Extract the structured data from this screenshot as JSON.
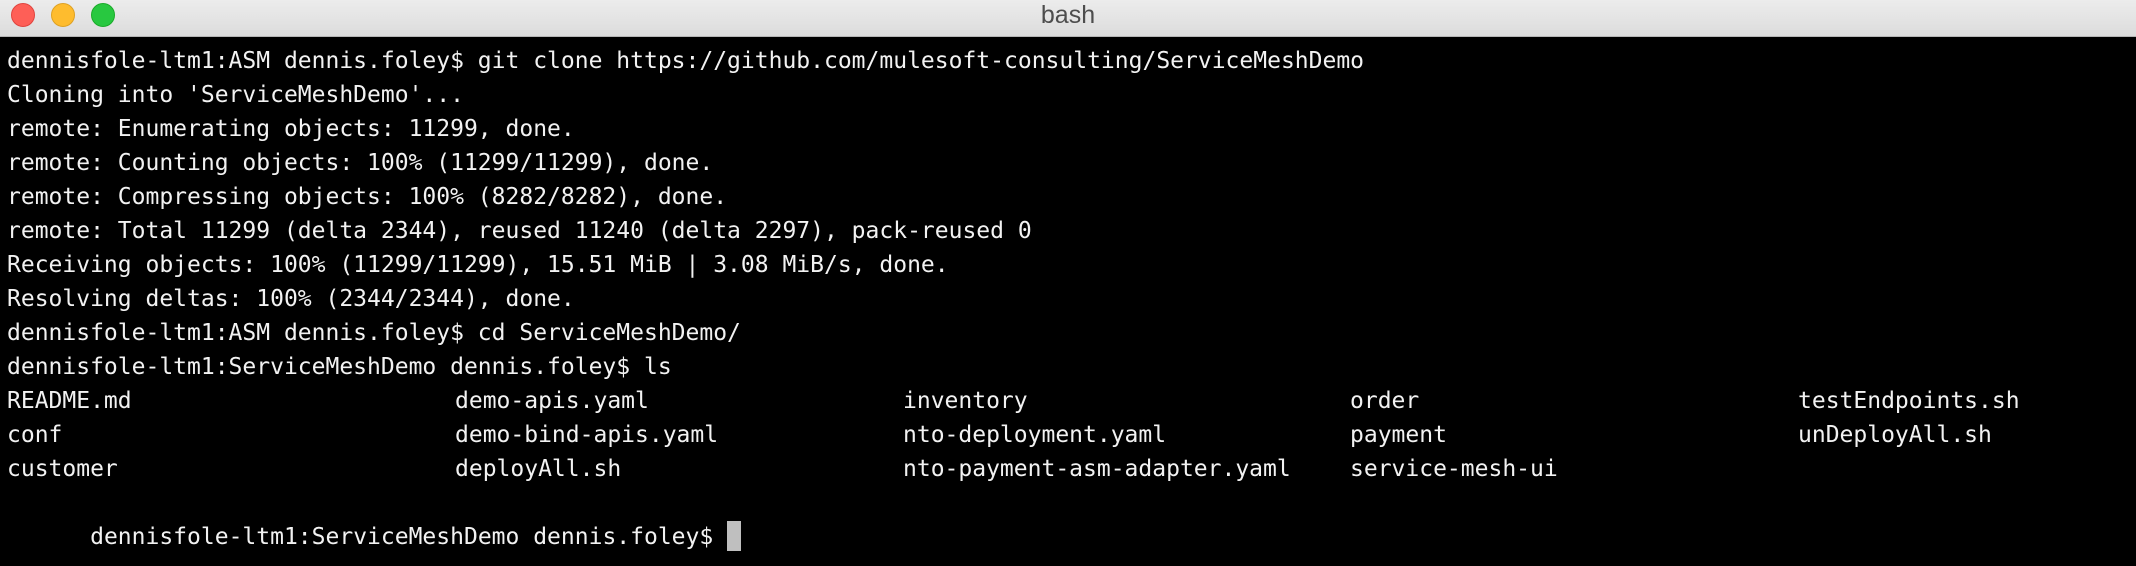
{
  "window": {
    "title": "bash"
  },
  "terminal": {
    "lines": [
      "dennisfole-ltm1:ASM dennis.foley$ git clone https://github.com/mulesoft-consulting/ServiceMeshDemo",
      "Cloning into 'ServiceMeshDemo'...",
      "remote: Enumerating objects: 11299, done.",
      "remote: Counting objects: 100% (11299/11299), done.",
      "remote: Compressing objects: 100% (8282/8282), done.",
      "remote: Total 11299 (delta 2344), reused 11240 (delta 2297), pack-reused 0",
      "Receiving objects: 100% (11299/11299), 15.51 MiB | 3.08 MiB/s, done.",
      "Resolving deltas: 100% (2344/2344), done.",
      "dennisfole-ltm1:ASM dennis.foley$ cd ServiceMeshDemo/",
      "dennisfole-ltm1:ServiceMeshDemo dennis.foley$ ls"
    ],
    "ls_rows": [
      [
        "README.md",
        "demo-apis.yaml",
        "inventory",
        "order",
        "testEndpoints.sh"
      ],
      [
        "conf",
        "demo-bind-apis.yaml",
        "nto-deployment.yaml",
        "payment",
        "unDeployAll.sh"
      ],
      [
        "customer",
        "deployAll.sh",
        "nto-payment-asm-adapter.yaml",
        "service-mesh-ui",
        ""
      ]
    ],
    "prompt": "dennisfole-ltm1:ServiceMeshDemo dennis.foley$"
  },
  "colors": {
    "background": "#000000",
    "foreground": "#f2f2f2",
    "cursor": "#bfbfbf",
    "close": "#fe5f57",
    "minimize": "#febc2e",
    "zoom": "#28c840"
  }
}
